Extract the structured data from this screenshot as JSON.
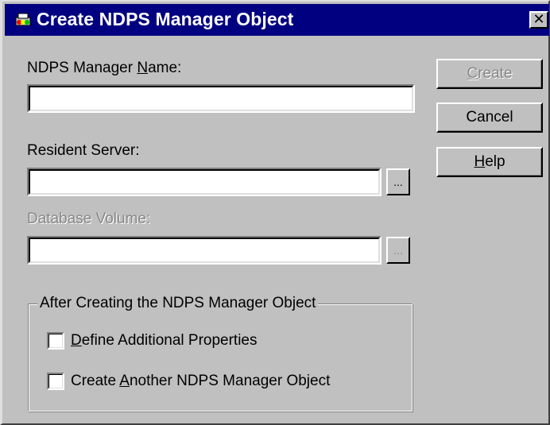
{
  "window": {
    "title": "Create NDPS Manager Object",
    "close_glyph": "✕",
    "icon": "ndps-printer-icon"
  },
  "fields": {
    "manager_name": {
      "label_pre": "NDPS Manager ",
      "label_accel": "N",
      "label_post": "ame:",
      "value": ""
    },
    "resident_server": {
      "label": "Resident Server:",
      "value": "",
      "browse_label": "..."
    },
    "database_volume": {
      "label": "Database Volume:",
      "value": "",
      "browse_label": "...",
      "enabled": false
    }
  },
  "buttons": {
    "create": {
      "accel": "C",
      "rest": "reate",
      "enabled": false
    },
    "cancel": {
      "label": "Cancel"
    },
    "help": {
      "accel": "H",
      "rest": "elp"
    }
  },
  "after_create_group": {
    "legend": "After Creating the NDPS Manager Object",
    "options": [
      {
        "accel": "D",
        "rest": "efine Additional Properties",
        "checked": false
      },
      {
        "pre": "Create ",
        "accel": "A",
        "rest": "nother NDPS Manager Object",
        "checked": false
      }
    ]
  },
  "colors": {
    "titlebar": "#000080",
    "dialog_face": "#c0c0c0",
    "disabled_text": "#888888"
  }
}
